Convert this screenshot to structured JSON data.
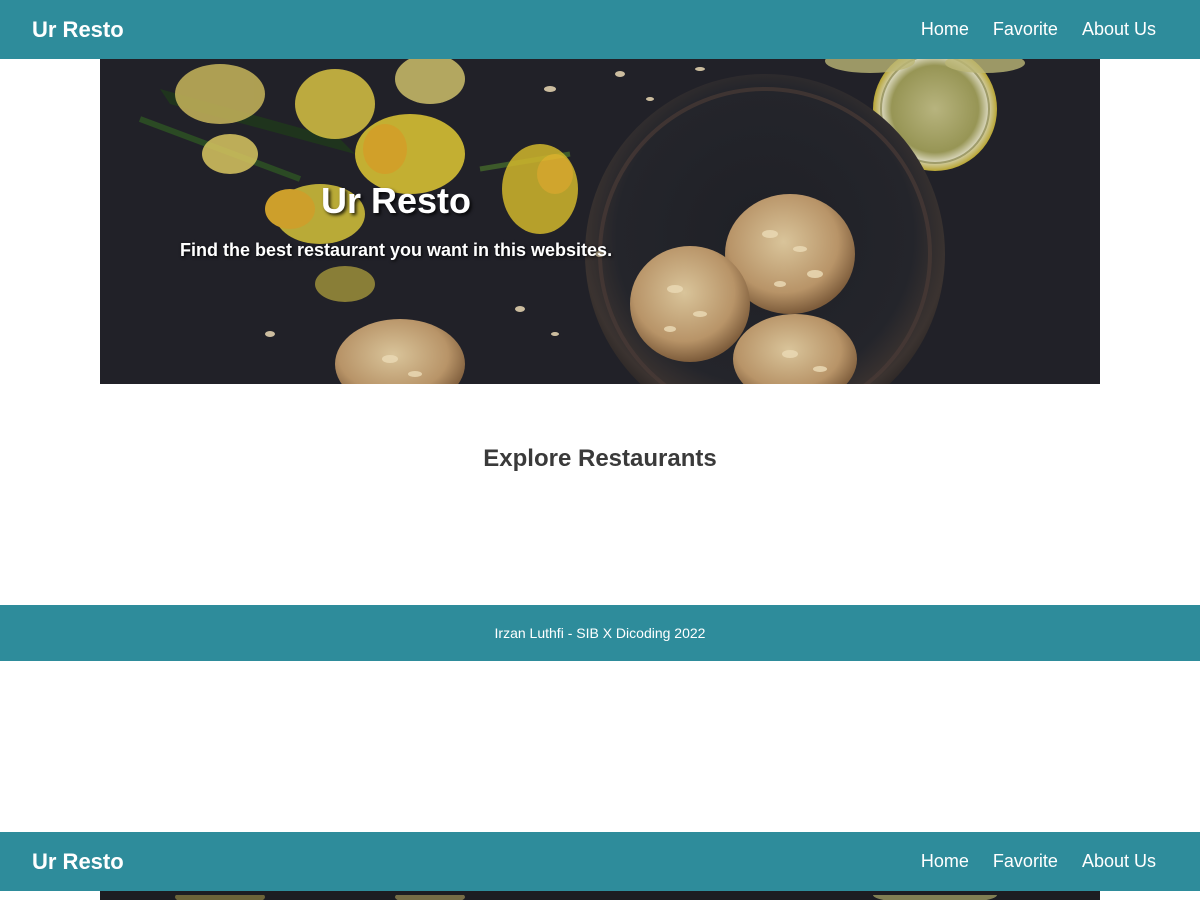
{
  "header": {
    "brand": "Ur Resto",
    "nav": [
      {
        "label": "Home"
      },
      {
        "label": "Favorite"
      },
      {
        "label": "About Us"
      }
    ]
  },
  "hero": {
    "title": "Ur Resto",
    "subtitle": "Find the best restaurant you want in this websites."
  },
  "main": {
    "section_title": "Explore Restaurants"
  },
  "footer": {
    "text": "Irzan Luthfi - SIB X Dicoding 2022"
  },
  "colors": {
    "primary": "#2e8c9b",
    "hero_background": "#1c1d22",
    "heading_text": "#3a3a3a",
    "on_primary_text": "#ffffff"
  }
}
